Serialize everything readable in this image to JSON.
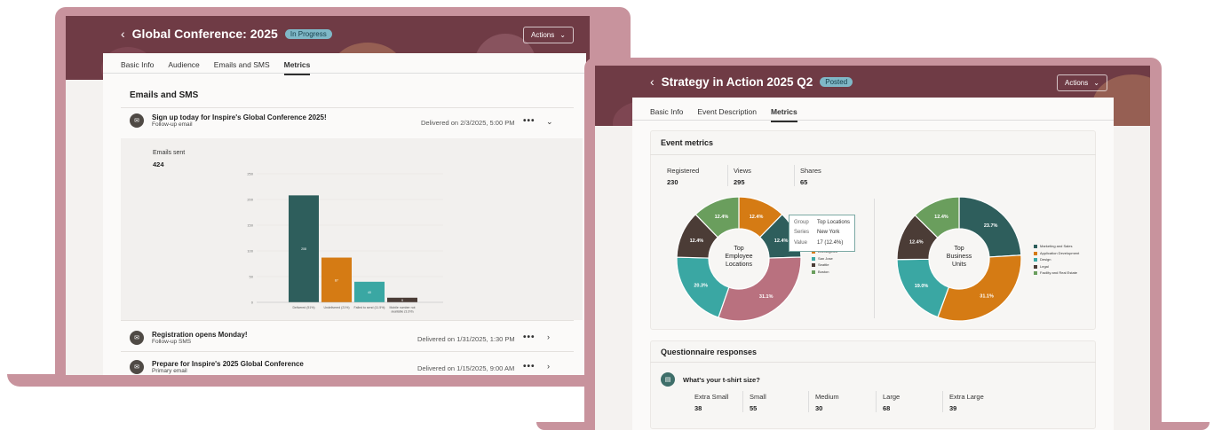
{
  "colors": {
    "frame": "#c8939d",
    "banner": "#6f3b45",
    "teal": "#2e5e5c",
    "orange": "#d57b14",
    "aqua": "#3aa7a3",
    "rose": "#b9717f",
    "green": "#6a9e5d",
    "brown": "#4b3c36"
  },
  "left": {
    "back_icon": "chevron-left-icon",
    "title": "Global Conference: 2025",
    "status": "In Progress",
    "actions": "Actions",
    "tabs": [
      "Basic Info",
      "Audience",
      "Emails and SMS",
      "Metrics"
    ],
    "active_tab": "Metrics",
    "section_title": "Emails and SMS",
    "emails": [
      {
        "title": "Sign up today for Inspire's Global Conference 2025!",
        "subtitle": "Follow-up email",
        "delivered": "Delivered on 2/3/2025, 5:00 PM"
      },
      {
        "title": "Registration opens Monday!",
        "subtitle": "Follow-up SMS",
        "delivered": "Delivered on 1/31/2025, 1:30 PM"
      },
      {
        "title": "Prepare for Inspire's 2025 Global Conference",
        "subtitle": "Primary email",
        "delivered": "Delivered on 1/15/2025, 9:00 AM"
      }
    ],
    "emails_sent_label": "Emails sent",
    "emails_sent_value": "424",
    "chart_data": {
      "type": "bar",
      "categories": [
        "Delivered (51%)",
        "Undelivered (21%)",
        "Failed to send (11.5%)",
        "Mobile number not available (3.3%)"
      ],
      "values": [
        208,
        87,
        40,
        9
      ],
      "yticks": [
        "250",
        "200",
        "150",
        "100",
        "50",
        "0"
      ],
      "ylim": [
        0,
        250
      ]
    }
  },
  "right": {
    "back_icon": "chevron-left-icon",
    "title": "Strategy in Action 2025 Q2",
    "status": "Posted",
    "actions": "Actions",
    "tabs": [
      "Basic Info",
      "Event Description",
      "Metrics"
    ],
    "active_tab": "Metrics",
    "event_metrics_title": "Event metrics",
    "metrics": [
      {
        "label": "Registered",
        "value": "230"
      },
      {
        "label": "Views",
        "value": "295"
      },
      {
        "label": "Shares",
        "value": "65"
      }
    ],
    "donut1": {
      "center": [
        "Top",
        "Employee",
        "Locations"
      ],
      "chart_data": {
        "type": "pie",
        "slices": [
          {
            "label": "12.4%",
            "value": 12.4,
            "color": "#d57b14"
          },
          {
            "label": "12.4%",
            "value": 12.4,
            "color": "#2e5e5c"
          },
          {
            "label": "31.1%",
            "value": 31.1,
            "color": "#b9717f"
          },
          {
            "label": "20.3%",
            "value": 20.3,
            "color": "#3aa7a3"
          },
          {
            "label": "12.4%",
            "value": 12.4,
            "color": "#4b3c36"
          },
          {
            "label": "12.4%",
            "value": 12.4,
            "color": "#6a9e5d"
          }
        ]
      },
      "legend": [
        "Los Angeles",
        "San Jose",
        "Seattle",
        "Boston"
      ],
      "tooltip": {
        "group_k": "Group",
        "group_v": "Top Locations",
        "series_k": "Series",
        "series_v": "New York",
        "value_k": "Value",
        "value_v": "17 (12.4%)"
      }
    },
    "donut2": {
      "center": [
        "Top",
        "Business",
        "Units"
      ],
      "chart_data": {
        "type": "pie",
        "slices": [
          {
            "label": "23.7%",
            "value": 23.7,
            "color": "#2e5e5c"
          },
          {
            "label": "31.1%",
            "value": 31.1,
            "color": "#d57b14"
          },
          {
            "label": "19.0%",
            "value": 19.0,
            "color": "#3aa7a3"
          },
          {
            "label": "12.4%",
            "value": 12.4,
            "color": "#4b3c36"
          },
          {
            "label": "12.4%",
            "value": 12.4,
            "color": "#6a9e5d"
          }
        ]
      },
      "legend": [
        "Marketing and Sales",
        "Application Development",
        "Design",
        "Legal",
        "Facility and Real Estate"
      ]
    },
    "questionnaire_title": "Questionnaire responses",
    "question": "What's your t-shirt size?",
    "sizes": [
      {
        "label": "Extra Small",
        "value": "38"
      },
      {
        "label": "Small",
        "value": "55"
      },
      {
        "label": "Medium",
        "value": "30"
      },
      {
        "label": "Large",
        "value": "68"
      },
      {
        "label": "Extra Large",
        "value": "39"
      }
    ]
  }
}
